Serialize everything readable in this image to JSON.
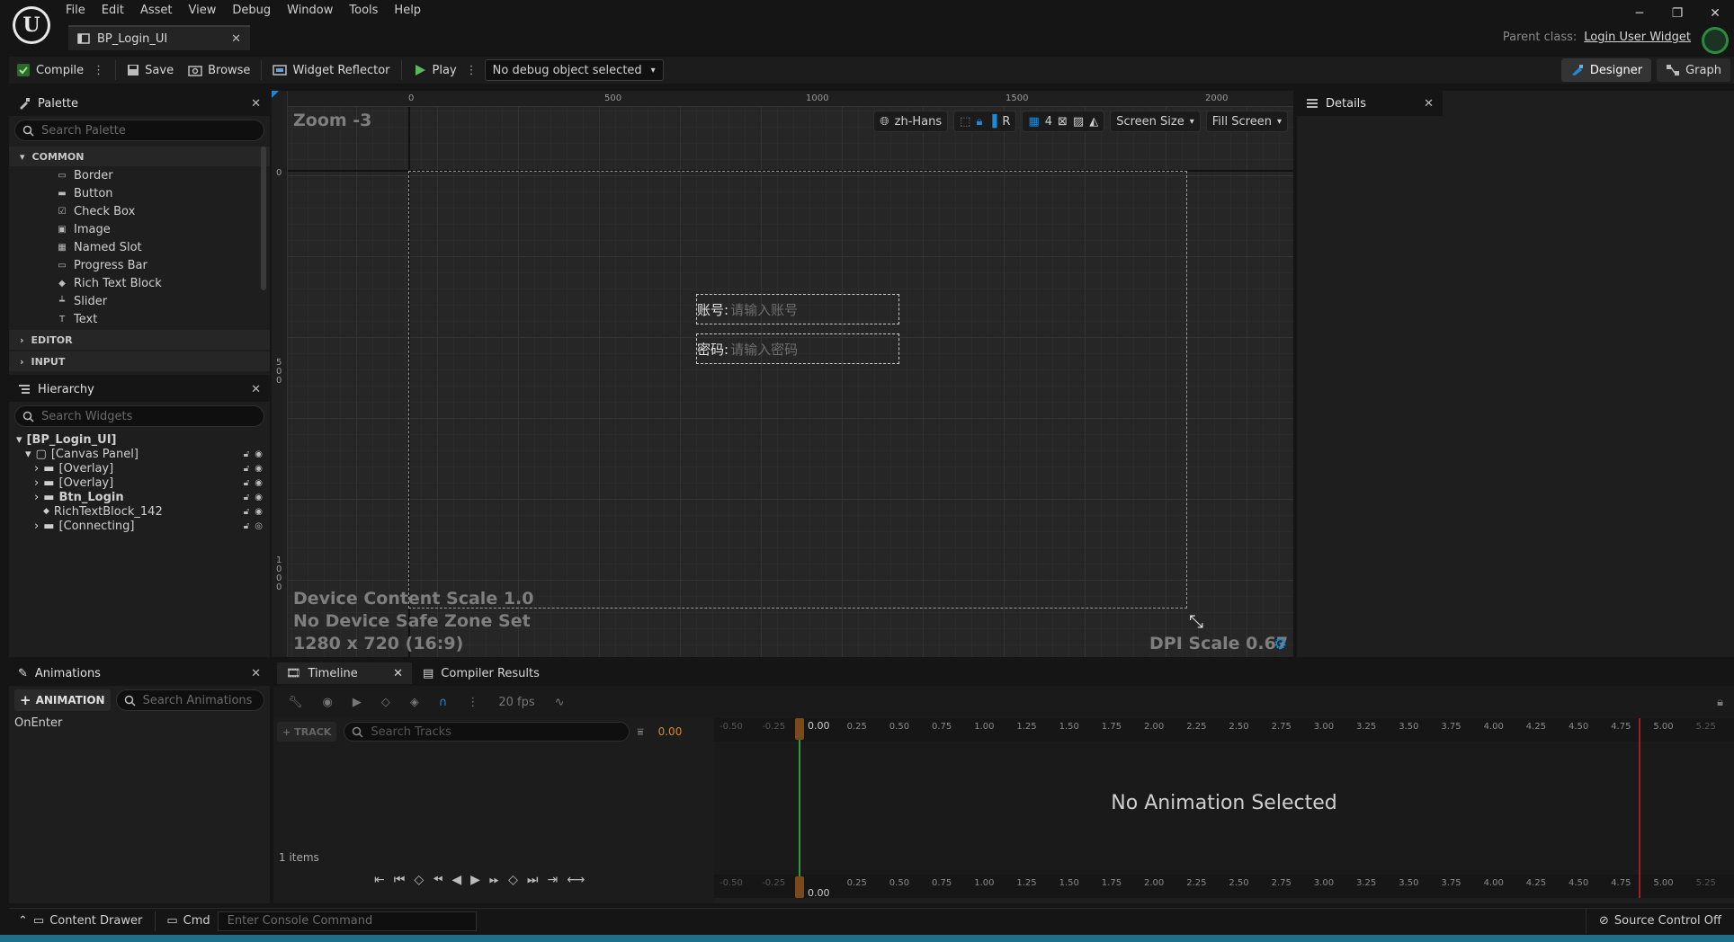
{
  "menu": [
    "File",
    "Edit",
    "Asset",
    "View",
    "Debug",
    "Window",
    "Tools",
    "Help"
  ],
  "doc_tab": {
    "title": "BP_Login_UI"
  },
  "parent_class": {
    "label": "Parent class:",
    "value": "Login User Widget"
  },
  "toolbar": {
    "compile": "Compile",
    "save": "Save",
    "browse": "Browse",
    "widget_reflector": "Widget Reflector",
    "play": "Play",
    "debug_object": "No debug object selected",
    "designer": "Designer",
    "graph": "Graph"
  },
  "palette": {
    "title": "Palette",
    "search_placeholder": "Search Palette",
    "categories": {
      "common": "COMMON",
      "editor": "EDITOR",
      "input": "INPUT"
    },
    "items": [
      "Border",
      "Button",
      "Check Box",
      "Image",
      "Named Slot",
      "Progress Bar",
      "Rich Text Block",
      "Slider",
      "Text"
    ]
  },
  "hierarchy": {
    "title": "Hierarchy",
    "search_placeholder": "Search Widgets",
    "root": "[BP_Login_UI]",
    "canvas": "[Canvas Panel]",
    "children": [
      "[Overlay]",
      "[Overlay]",
      "Btn_Login",
      "RichTextBlock_142",
      "[Connecting]"
    ]
  },
  "designer": {
    "zoom": "Zoom -3",
    "ruler_top": [
      "0",
      "500",
      "1000",
      "1500",
      "2000"
    ],
    "ruler_left_0": "0",
    "ruler_left_500": "5\n0\n0",
    "ruler_left_1000": "1\n0\n0\n0",
    "culture": "zh-Hans",
    "r_label": "R",
    "grid_count": "4",
    "screen_size": "Screen Size",
    "fill_screen": "Fill Screen",
    "account_label": "账号:",
    "account_placeholder": "请输入账号",
    "password_label": "密码:",
    "password_placeholder": "请输入密码",
    "content_scale": "Device Content Scale 1.0",
    "safe_zone": "No Device Safe Zone Set",
    "resolution": "1280 x 720 (16:9)",
    "dpi_scale": "DPI Scale 0.67"
  },
  "details": {
    "title": "Details"
  },
  "animations": {
    "title": "Animations",
    "add_button": "ANIMATION",
    "search_placeholder": "Search Animations",
    "items": [
      "OnEnter"
    ]
  },
  "timeline": {
    "tab_timeline": "Timeline",
    "tab_compiler": "Compiler Results",
    "fps": "20 fps",
    "track_button": "TRACK",
    "search_placeholder": "Search Tracks",
    "current_time": "0.00",
    "playhead_time": "0.00",
    "items_count": "1 items",
    "empty_message": "No Animation Selected",
    "ticks": [
      "-0.50",
      "-0.25",
      "0.25",
      "0.50",
      "0.75",
      "1.00",
      "1.25",
      "1.50",
      "1.75",
      "2.00",
      "2.25",
      "2.50",
      "2.75",
      "3.00",
      "3.25",
      "3.50",
      "3.75",
      "4.00",
      "4.25",
      "4.50",
      "4.75",
      "5.00",
      "5.25"
    ]
  },
  "statusbar": {
    "content_drawer": "Content Drawer",
    "cmd": "Cmd",
    "console_placeholder": "Enter Console Command",
    "source_control": "Source Control Off"
  },
  "colors": {
    "accent_blue": "#1e8ad6",
    "play_green": "#4caf50",
    "time_orange": "#d08a2a",
    "playhead_green": "#2e9a3a",
    "end_red": "#a02020"
  }
}
